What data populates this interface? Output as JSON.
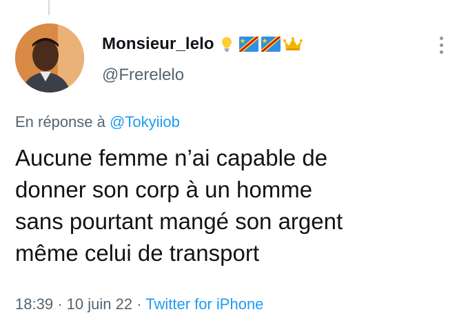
{
  "author": {
    "display_name": "Monsieur_lelo",
    "handle": "@Frerelelo",
    "name_emojis": [
      "lightbulb-emoji",
      "drc-flag-emoji",
      "drc-flag-emoji",
      "crown-emoji"
    ]
  },
  "reply": {
    "prefix": "En réponse à",
    "mention": "@Tokyiiob"
  },
  "tweet": {
    "lines": [
      "Aucune femme n’ai capable de",
      "donner son corp à un homme",
      "sans pourtant mangé son argent",
      "même celui de transport"
    ]
  },
  "meta": {
    "time": "18:39",
    "separator": "·",
    "date": "10 juin 22",
    "source": "Twitter for iPhone"
  },
  "icons": {
    "more_menu": "more-vertical-icon"
  },
  "colors": {
    "link": "#1d9bf0",
    "secondary_text": "#536471",
    "primary_text": "#0f1419"
  }
}
